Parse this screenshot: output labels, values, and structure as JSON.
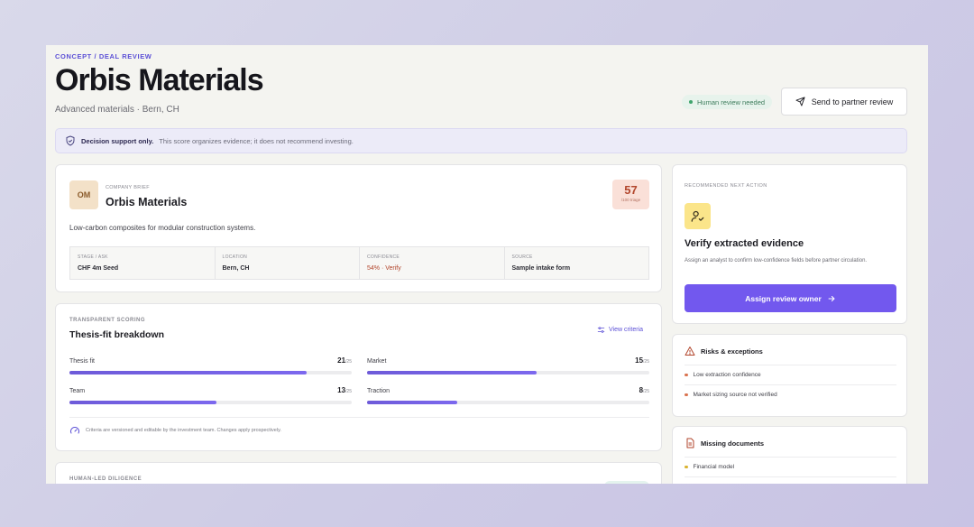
{
  "header": {
    "eyebrow": "CONCEPT / DEAL REVIEW",
    "title": "Orbis Materials",
    "subtitle": "Advanced materials · Bern, CH",
    "review_pill": "Human review needed",
    "send_button": "Send to partner review"
  },
  "notice": {
    "strong": "Decision support only.",
    "text": "This score organizes evidence; it does not recommend investing."
  },
  "brief": {
    "avatar": "OM",
    "eyebrow": "COMPANY BRIEF",
    "name": "Orbis Materials",
    "score": "57",
    "score_label": "/100 triage",
    "description": "Low-carbon composites for modular construction systems.",
    "facts": [
      {
        "key": "STAGE / ASK",
        "value": "CHF 4m Seed"
      },
      {
        "key": "LOCATION",
        "value": "Bern, CH"
      },
      {
        "key": "CONFIDENCE",
        "value": "54% · Verify"
      },
      {
        "key": "SOURCE",
        "value": "Sample intake form"
      }
    ]
  },
  "scoring": {
    "eyebrow": "TRANSPARENT SCORING",
    "title": "Thesis-fit breakdown",
    "view_criteria": "View criteria",
    "metrics": [
      {
        "label": "Thesis fit",
        "value": "21",
        "max": "/25",
        "fraction": 0.84
      },
      {
        "label": "Market",
        "value": "15",
        "max": "/25",
        "fraction": 0.6
      },
      {
        "label": "Team",
        "value": "13",
        "max": "/25",
        "fraction": 0.52
      },
      {
        "label": "Traction",
        "value": "8",
        "max": "/25",
        "fraction": 0.32
      }
    ],
    "note": "Criteria are versioned and editable by the investment team. Changes apply prospectively."
  },
  "diligence": {
    "eyebrow": "HUMAN-LED DILIGENCE"
  },
  "action": {
    "eyebrow": "RECOMMENDED NEXT ACTION",
    "title": "Verify extracted evidence",
    "description": "Assign an analyst to confirm low-confidence fields before partner circulation.",
    "button": "Assign review owner"
  },
  "risks": {
    "title": "Risks & exceptions",
    "items": [
      "Low extraction confidence",
      "Market sizing source not verified"
    ]
  },
  "missing": {
    "title": "Missing documents",
    "items": [
      "Financial model"
    ]
  },
  "colors": {
    "accent": "#7258ee",
    "warning": "#b2462c",
    "success": "#3fa46c",
    "highlight": "#fbe58a"
  }
}
